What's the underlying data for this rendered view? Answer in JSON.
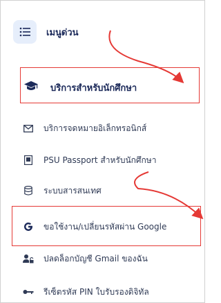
{
  "quick_menu": {
    "label": "เมนูด่วน",
    "icon": "list-menu-icon"
  },
  "section": {
    "label": "บริการสำหรับนักศึกษา",
    "icon": "graduation-cap-icon"
  },
  "items": [
    {
      "label": "บริการจดหมายอิเล็กทรอนิกส์",
      "icon": "envelope-icon"
    },
    {
      "label": "PSU Passport สำหรับนักศึกษา",
      "icon": "id-card-icon"
    },
    {
      "label": "ระบบสารสนเทศ",
      "icon": "database-icon"
    },
    {
      "label": "ขอใช้งาน/เปลี่ยนรหัสผ่าน Google",
      "icon": "google-icon"
    },
    {
      "label": "ปลดล็อกบัญชี Gmail ของฉัน",
      "icon": "user-unlock-icon"
    },
    {
      "label": "รีเซ็ตรหัส PIN ใบรับรองดิจิทัล",
      "icon": "key-icon"
    }
  ],
  "colors": {
    "text_dark": "#1c2a5a",
    "text_item": "#2f3a55",
    "highlight": "#e53935",
    "icon_bg": "#e6eefb"
  }
}
